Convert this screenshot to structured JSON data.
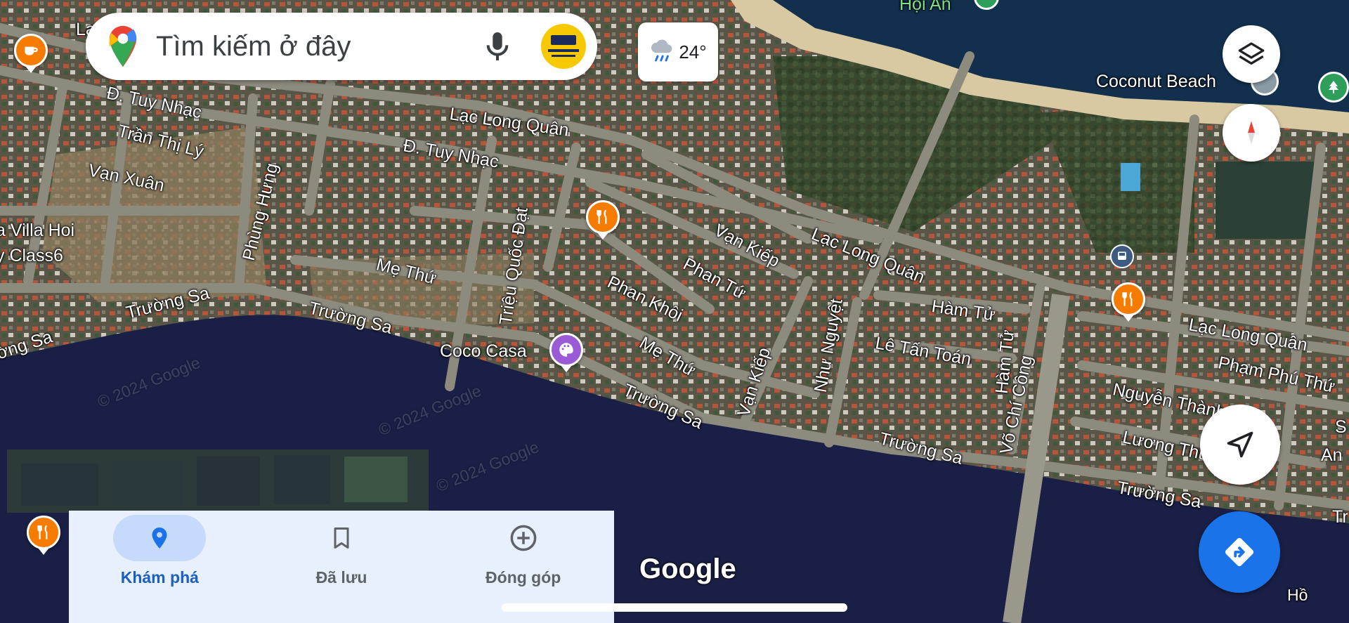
{
  "search": {
    "placeholder": "Tìm kiếm ở đây"
  },
  "weather": {
    "temp": "24°"
  },
  "map": {
    "labels": {
      "hoi_an": "Hội An",
      "coconut_beach": "Coconut Beach",
      "d_tuy_nhac_1": "Đ. Tuy Nhạc",
      "d_tuy_nhac_2": "Đ. Tuy Nhạc",
      "tran_thi_ly": "Trần Thị Lý",
      "van_xuan": "Vạn Xuân",
      "lac_long_quan_1": "Lạc Long Quân",
      "lac_long_quan_2": "Lạc Long Quân",
      "lac_long_quan_3": "Lạc Long Quân",
      "phung_hung": "Phùng Hưng",
      "villa_hoi": "a Villa Hoi",
      "class6": "y Class6",
      "me_thu_1": "Mẹ Thứ",
      "me_thu_2": "Mẹ Thứ",
      "truong_sa_1": "Trường Sa",
      "truong_sa_2": "Trường Sa",
      "truong_sa_3": "Trường Sa",
      "truong_sa_4": "Trường Sa",
      "truong_sa_5": "Trường Sa",
      "truong_sa_left": "ờng Sa",
      "trieu_quoc_dat": "Triệu Quốc Đạt",
      "van_kiep_1": "Vạn Kiếp",
      "van_kiep_2": "Vạn Kiếp",
      "phan_tu": "Phan Tứ",
      "phan_khoi": "Phan Khôi",
      "coco_casa": "Coco Casa",
      "nhu_nguyet": "Như Nguyệt",
      "ham_tu_1": "Hàm Tử",
      "ham_tu_2": "Hàm Tử",
      "le_tan_toan": "Lê Tấn Toán",
      "vo_chi_cong": "Võ Chí Công",
      "pham_phu_thu": "Phạm Phú Thứ",
      "nguyen_thanh_y": "Nguyễn Thành Ý",
      "luong_thuc": "Lương Thúc",
      "edge_s": "S",
      "edge_an": "An",
      "edge_tr": "Tr",
      "edge_la": "La",
      "edge_ho": "Hồ",
      "google": "Google",
      "copyright_1": "© 2024 Google",
      "copyright_2": "© 2024 Google",
      "copyright_3": "© 2024 Google"
    },
    "colors": {
      "water": "#1a1f45",
      "land": "#4a4a3a",
      "road": "#8d8a7e",
      "restaurant_pin": "#f57c00",
      "cafe_pin": "#f57c00",
      "art_pin": "#9c5bd6"
    }
  },
  "nav": {
    "items": [
      {
        "label": "Khám phá",
        "icon": "location-pin-icon",
        "active": true
      },
      {
        "label": "Đã lưu",
        "icon": "bookmark-icon",
        "active": false
      },
      {
        "label": "Đóng góp",
        "icon": "add-circle-icon",
        "active": false
      }
    ]
  }
}
